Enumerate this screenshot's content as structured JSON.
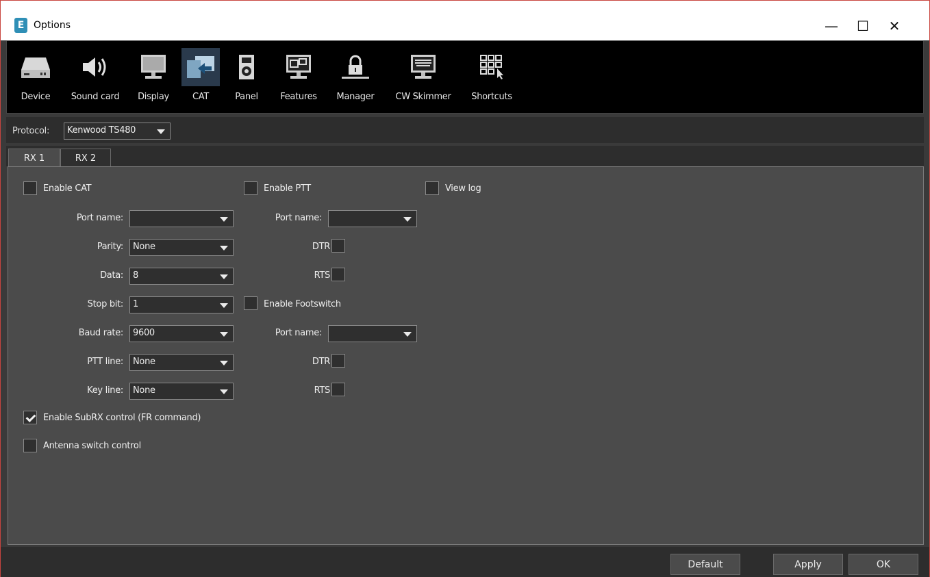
{
  "window": {
    "title": "Options",
    "app_icon": "E",
    "controls": {
      "minimize": "—",
      "maximize": "☐",
      "close": "✕"
    }
  },
  "toolbar": {
    "items": [
      {
        "label": "Device",
        "icon": "device-icon"
      },
      {
        "label": "Sound card",
        "icon": "speaker-icon"
      },
      {
        "label": "Display",
        "icon": "monitor-icon"
      },
      {
        "label": "CAT",
        "icon": "cat-icon",
        "active": true
      },
      {
        "label": "Panel",
        "icon": "panel-icon"
      },
      {
        "label": "Features",
        "icon": "features-icon"
      },
      {
        "label": "Manager",
        "icon": "lock-icon"
      },
      {
        "label": "CW Skimmer",
        "icon": "keyboard-monitor-icon"
      },
      {
        "label": "Shortcuts",
        "icon": "shortcuts-icon"
      }
    ]
  },
  "protocol": {
    "label": "Protocol:",
    "value": "Kenwood TS480"
  },
  "tabs": [
    {
      "label": "RX 1",
      "selected": true
    },
    {
      "label": "RX 2",
      "selected": false
    }
  ],
  "cat": {
    "enable_cat": {
      "label": "Enable CAT",
      "checked": false
    },
    "port_name": {
      "label": "Port name:",
      "value": ""
    },
    "parity": {
      "label": "Parity:",
      "value": "None"
    },
    "data": {
      "label": "Data:",
      "value": "8"
    },
    "stop_bit": {
      "label": "Stop bit:",
      "value": "1"
    },
    "baud_rate": {
      "label": "Baud rate:",
      "value": "9600"
    },
    "ptt_line": {
      "label": "PTT line:",
      "value": "None"
    },
    "key_line": {
      "label": "Key line:",
      "value": "None"
    },
    "enable_subrx": {
      "label": "Enable SubRX control (FR command)",
      "checked": true
    },
    "antenna_switch": {
      "label": "Antenna switch control",
      "checked": false
    }
  },
  "ptt": {
    "enable_ptt": {
      "label": "Enable PTT",
      "checked": false
    },
    "port_name": {
      "label": "Port name:",
      "value": ""
    },
    "dtr": {
      "label": "DTR",
      "checked": false
    },
    "rts": {
      "label": "RTS",
      "checked": false
    }
  },
  "footswitch": {
    "enable": {
      "label": "Enable Footswitch",
      "checked": false
    },
    "port_name": {
      "label": "Port name:",
      "value": ""
    },
    "dtr": {
      "label": "DTR",
      "checked": false
    },
    "rts": {
      "label": "RTS",
      "checked": false
    }
  },
  "view_log": {
    "label": "View log",
    "checked": false
  },
  "buttons": {
    "default": "Default",
    "apply": "Apply",
    "ok": "OK"
  },
  "colors": {
    "accent_border": "#c8453f",
    "panel_bg": "#4b4b4b",
    "toolbar_bg": "#000000",
    "active_tool": "#2a3a4c"
  }
}
